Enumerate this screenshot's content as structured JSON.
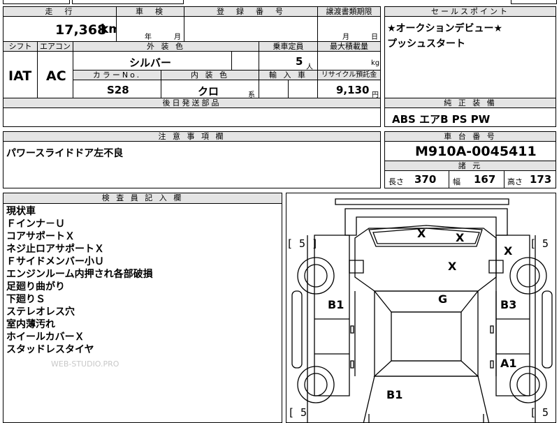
{
  "top_left_fragment": "",
  "mileage": {
    "label": "走　行",
    "value": "17,368",
    "unit": "km"
  },
  "inspection": {
    "label": "車　検",
    "year_unit": "年",
    "month_unit": "月"
  },
  "registration": {
    "label": "登　録　番　号",
    "value": ""
  },
  "transfer_deadline": {
    "label": "譲渡書類期限",
    "month_unit": "月",
    "day_unit": "日"
  },
  "sales_point": {
    "label": "セールスポイント",
    "lines": [
      "★オークションデビュー★",
      "プッシュスタート"
    ]
  },
  "shift": {
    "label": "シフト",
    "value": "IAT"
  },
  "aircon": {
    "label": "エアコン",
    "value": "AC"
  },
  "exterior_color": {
    "label": "外 装 色",
    "value": "シルバー"
  },
  "capacity": {
    "label": "乗車定員",
    "value": "5",
    "unit": "人"
  },
  "max_load": {
    "label": "最大積載量",
    "value": "",
    "unit": "kg"
  },
  "color_no": {
    "label": "カラーNo.",
    "value": "S28"
  },
  "interior_color": {
    "label": "内 装 色",
    "value": "クロ",
    "suffix": "系"
  },
  "import": {
    "label": "輸 入 車",
    "value": ""
  },
  "recycle": {
    "label": "リサイクル預託金",
    "value": "9,130",
    "unit": "円"
  },
  "later_parts": {
    "label": "後日発送部品",
    "value": ""
  },
  "standard_equipment": {
    "label": "純 正 装 備",
    "value": "ABS エアB PS PW"
  },
  "notes": {
    "label": "注 意 事 項 欄",
    "value": "パワースライドドア左不良"
  },
  "chassis": {
    "label": "車 台 番 号",
    "value": "M910A-0045411"
  },
  "dimensions": {
    "label": "諸 元",
    "length_label": "長さ",
    "length": "370",
    "width_label": "幅",
    "width": "167",
    "height_label": "高さ",
    "height": "173"
  },
  "inspector": {
    "label": "検 査 員 記 入 欄",
    "lines": [
      "現状車",
      "Ｆインナ－Ｕ",
      "コアサポートＸ",
      "ネジ止ロアサポートＸ",
      "Ｆサイドメンバー小Ｕ",
      "エンジンルーム内押され各部破損",
      "足廻り曲がり",
      "下廻りＳ",
      "ステレオレス穴",
      "室内薄汚れ",
      "ホイールカバーＸ",
      "スタッドレスタイヤ"
    ],
    "watermark": "WEB-STUDIO.PRO"
  },
  "diagram": {
    "tire_left_front": "[ 5 ]",
    "tire_right_front": "[ 5 ]",
    "tire_left_rear": "[ 5",
    "tire_right_rear": "[ 5",
    "marks": {
      "hood_a": "X",
      "hood_b": "X",
      "fender_rf": "X",
      "engine": "X",
      "roof": "G",
      "door_lf": "B1",
      "door_rf": "B3",
      "door_rr": "A1",
      "rear": "B1"
    }
  }
}
